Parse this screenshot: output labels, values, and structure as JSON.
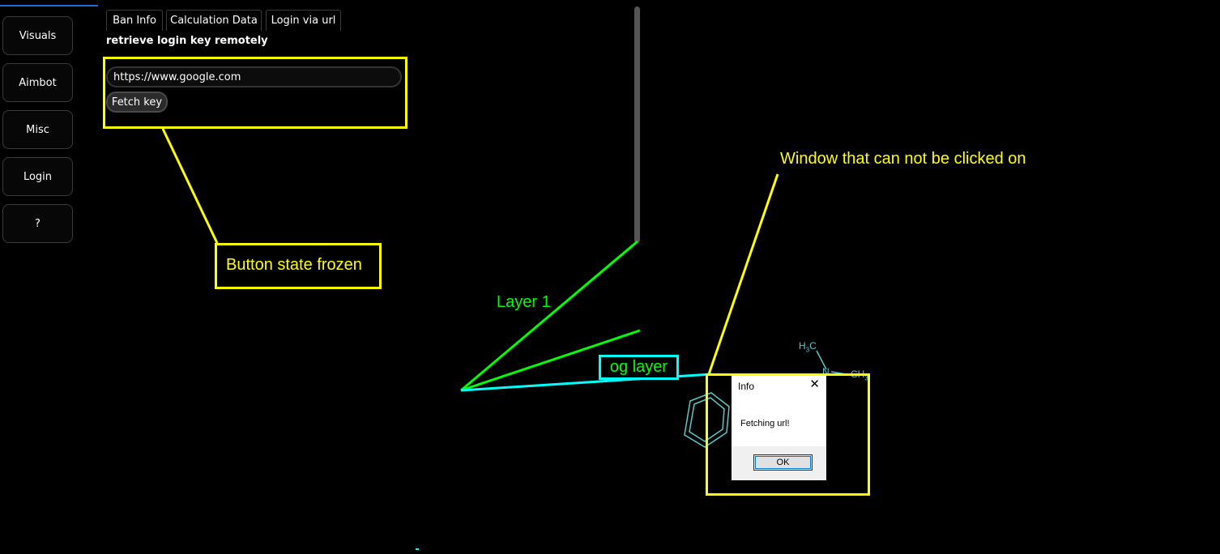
{
  "sidebar": {
    "items": [
      {
        "label": "Visuals"
      },
      {
        "label": "Aimbot"
      },
      {
        "label": "Misc"
      },
      {
        "label": "Login"
      },
      {
        "label": "?"
      }
    ]
  },
  "tabs": [
    {
      "label": "Ban Info"
    },
    {
      "label": "Calculation Data"
    },
    {
      "label": "Login via url"
    }
  ],
  "panel": {
    "subtitle": "retrieve login key remotely",
    "url_value": "https://www.google.com",
    "fetch_label": "Fetch key"
  },
  "annotations": {
    "button_frozen": "Button state frozen",
    "window_unclickable": "Window that can not be clicked on",
    "layer1": "Layer 1",
    "og_layer": "og layer"
  },
  "dialog": {
    "title": "Info",
    "message": "Fetching url!",
    "ok_label": "OK"
  },
  "molecule": {
    "h3c": "H",
    "h3c_sub": "3",
    "h3c_c": "C",
    "n": "N",
    "ch3": "CH",
    "ch3_sub": "3"
  },
  "colors": {
    "annotation_yellow": "#ffff00",
    "annotation_green": "#00ff00",
    "annotation_cyan": "#00ffff",
    "molecule": "#5cc8c8"
  }
}
